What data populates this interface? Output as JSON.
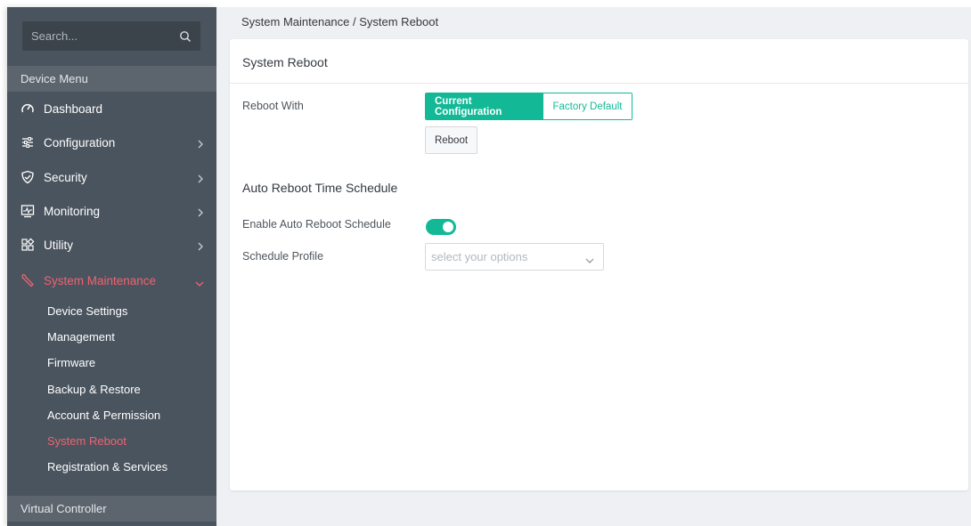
{
  "sidebar": {
    "search_placeholder": "Search...",
    "device_menu_label": "Device Menu",
    "items": [
      {
        "label": "Dashboard",
        "icon": "dashboard-gauge-icon"
      },
      {
        "label": "Configuration",
        "icon": "sliders-icon"
      },
      {
        "label": "Security",
        "icon": "shield-check-icon"
      },
      {
        "label": "Monitoring",
        "icon": "monitor-icon"
      },
      {
        "label": "Utility",
        "icon": "grid-tools-icon"
      },
      {
        "label": "System Maintenance",
        "icon": "wrench-icon"
      }
    ],
    "sub_items": [
      {
        "label": "Device Settings"
      },
      {
        "label": "Management"
      },
      {
        "label": "Firmware"
      },
      {
        "label": "Backup & Restore"
      },
      {
        "label": "Account & Permission"
      },
      {
        "label": "System Reboot"
      },
      {
        "label": "Registration & Services"
      }
    ],
    "virtual_controller_label": "Virtual Controller"
  },
  "header": {
    "breadcrumb": "System Maintenance / System Reboot"
  },
  "card": {
    "title": "System Reboot",
    "reboot_with_label": "Reboot With",
    "segment": {
      "current": "Current Configuration",
      "factory": "Factory Default"
    },
    "reboot_button": "Reboot",
    "auto_heading": "Auto Reboot Time Schedule",
    "enable_label": "Enable Auto Reboot Schedule",
    "schedule_label": "Schedule Profile",
    "schedule_placeholder": "select your options"
  },
  "colors": {
    "accent": "#13b996",
    "active_menu": "#f06272",
    "sidebar_bg": "#4a545e"
  }
}
